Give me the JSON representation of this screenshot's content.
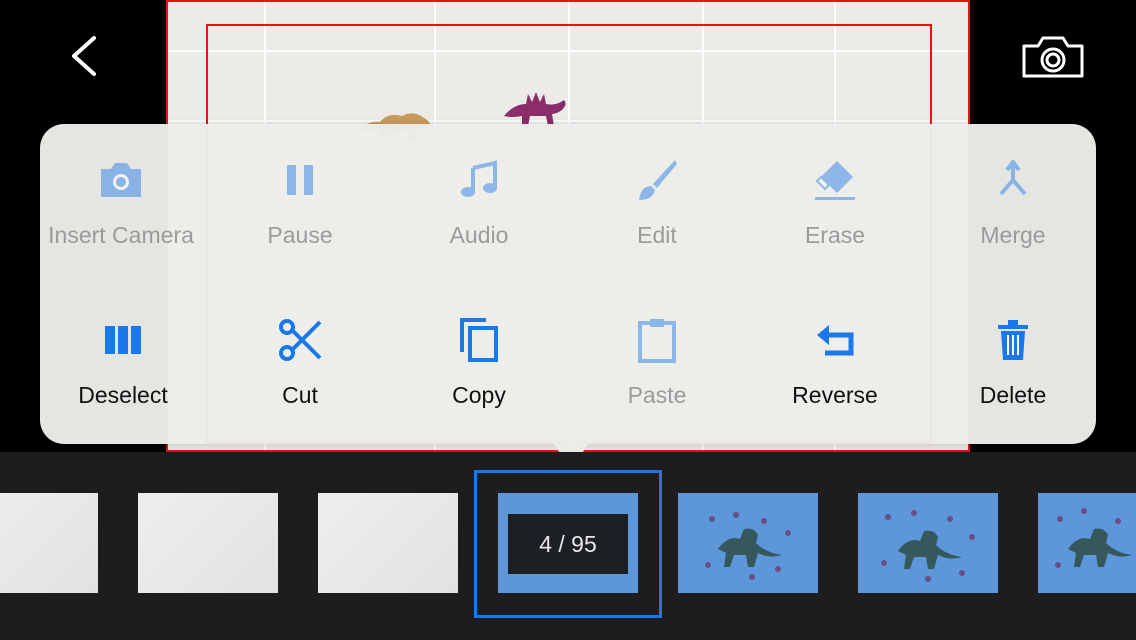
{
  "menu": {
    "row1": [
      {
        "label": "Insert Camera",
        "icon": "camera-icon",
        "enabled": false
      },
      {
        "label": "Pause",
        "icon": "pause-icon",
        "enabled": false
      },
      {
        "label": "Audio",
        "icon": "music-note-icon",
        "enabled": false
      },
      {
        "label": "Edit",
        "icon": "brush-icon",
        "enabled": false
      },
      {
        "label": "Erase",
        "icon": "eraser-icon",
        "enabled": false
      },
      {
        "label": "Merge",
        "icon": "merge-icon",
        "enabled": false
      }
    ],
    "row2": [
      {
        "label": "Deselect",
        "icon": "deselect-icon",
        "enabled": true
      },
      {
        "label": "Cut",
        "icon": "scissors-icon",
        "enabled": true
      },
      {
        "label": "Copy",
        "icon": "copy-icon",
        "enabled": true
      },
      {
        "label": "Paste",
        "icon": "clipboard-icon",
        "enabled": false
      },
      {
        "label": "Reverse",
        "icon": "reverse-icon",
        "enabled": true
      },
      {
        "label": "Delete",
        "icon": "trash-icon",
        "enabled": true
      }
    ]
  },
  "filmstrip": {
    "counter": "4 / 95",
    "selected_index": 4,
    "total": 95
  },
  "colors": {
    "accent": "#1b78e8",
    "frame_border": "#e81414",
    "filmstrip_bg": "#1d1d1f"
  }
}
